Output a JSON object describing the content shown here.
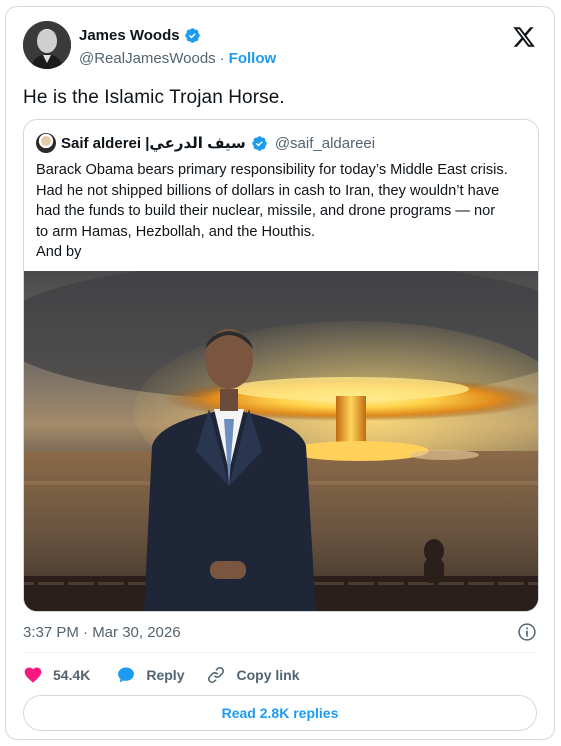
{
  "author": {
    "name": "James Woods",
    "handle": "@RealJamesWoods",
    "separator": "·",
    "follow_label": "Follow",
    "verified_color": "#1d9bf0"
  },
  "tweet": {
    "text": "He is the Islamic Trojan Horse.",
    "timestamp": "3:37 PM · Mar 30, 2026"
  },
  "quote": {
    "name": "Saif alderei |سيف الدرعي",
    "handle": "@saif_aldareei",
    "lines": [
      "Barack Obama bears primary responsibility for today’s Middle East crisis.",
      "Had he not shipped billions of dollars in cash to Iran, they wouldn’t have",
      "had the funds to build their nuclear, missile, and drone programs — nor",
      "to arm Hamas, Hezbollah, and the Houthis.",
      "And by"
    ],
    "image_alt": "photo-suited-man-before-mushroom-cloud"
  },
  "actions": {
    "likes": "54.4K",
    "reply_label": "Reply",
    "copy_label": "Copy link",
    "like_color": "#f91880",
    "reply_color": "#1d9bf0"
  },
  "read_replies_label": "Read 2.8K replies",
  "icons": [
    "verified-badge-icon",
    "x-logo-icon",
    "info-icon",
    "heart-icon",
    "reply-bubble-icon",
    "link-icon"
  ]
}
